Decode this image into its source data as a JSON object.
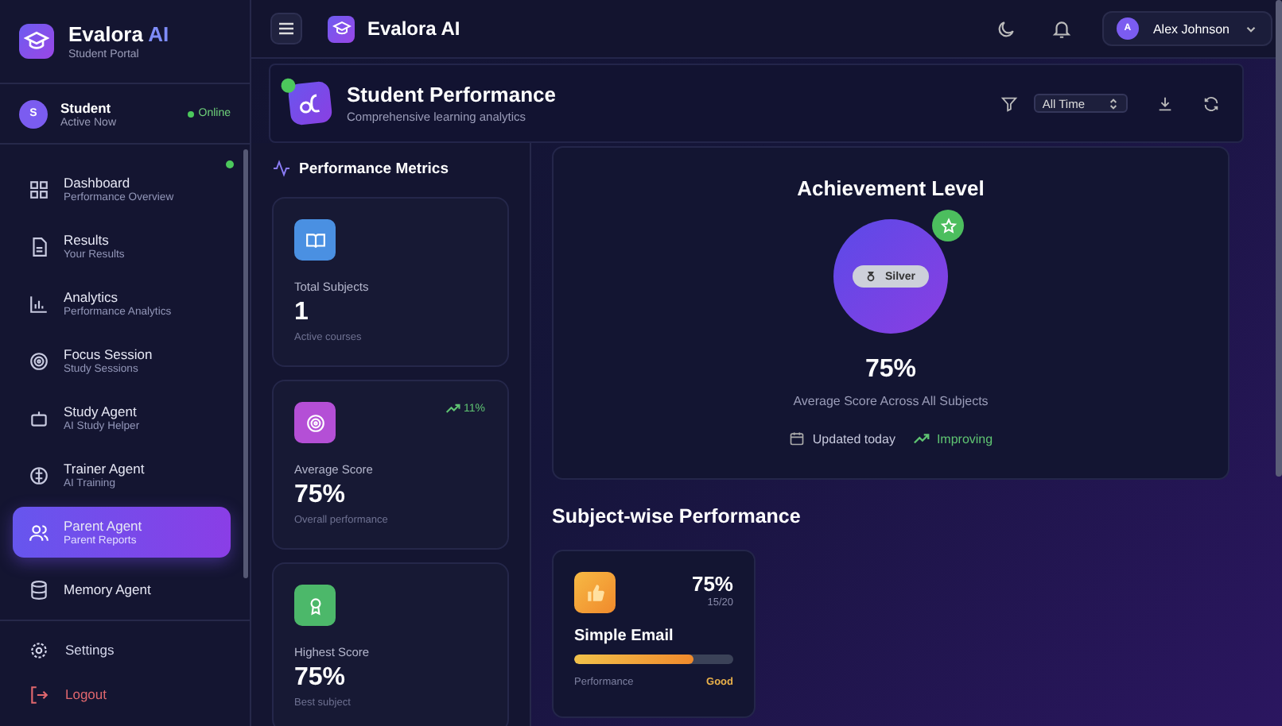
{
  "sidebar": {
    "brand": {
      "name": "Evalora",
      "name_accent": "AI",
      "subtitle": "Student Portal"
    },
    "user": {
      "initial": "S",
      "name": "Student",
      "status": "Active Now",
      "presence": "Online"
    },
    "items": [
      {
        "label": "Dashboard",
        "subtitle": "Performance Overview",
        "selected": false
      },
      {
        "label": "Results",
        "subtitle": "Your Results",
        "selected": false
      },
      {
        "label": "Analytics",
        "subtitle": "Performance Analytics",
        "selected": false
      },
      {
        "label": "Focus Session",
        "subtitle": "Study Sessions",
        "selected": false
      },
      {
        "label": "Study Agent",
        "subtitle": "AI Study Helper",
        "selected": false
      },
      {
        "label": "Trainer Agent",
        "subtitle": "AI Training",
        "selected": false
      },
      {
        "label": "Parent Agent",
        "subtitle": "Parent Reports",
        "selected": true
      },
      {
        "label": "Memory Agent",
        "selected": false
      }
    ],
    "footer": [
      {
        "label": "Settings",
        "kind": "normal"
      },
      {
        "label": "Logout",
        "kind": "danger"
      }
    ]
  },
  "topbar": {
    "title": "Evalora AI",
    "user": {
      "initial": "A",
      "name": "Alex Johnson"
    }
  },
  "header": {
    "title": "Student Performance",
    "subtitle": "Comprehensive learning analytics",
    "filter": "All Time"
  },
  "metrics": {
    "title": "Performance Metrics",
    "cards": [
      {
        "color": "#4a90e2",
        "label": "Total Subjects",
        "value": "1",
        "note": "Active courses"
      },
      {
        "color": "#b44fd6",
        "label": "Average Score",
        "value": "75%",
        "note": "Overall performance",
        "trend": "11%"
      },
      {
        "color": "#4cb86a",
        "label": "Highest Score",
        "value": "75%",
        "note": "Best subject"
      }
    ]
  },
  "achievement": {
    "title": "Achievement Level",
    "badge": "Silver",
    "score": "75%",
    "caption": "Average Score Across All Subjects",
    "updated": "Updated today",
    "trend": "Improving"
  },
  "subjects": {
    "title": "Subject-wise Performance",
    "items": [
      {
        "name": "Simple Email",
        "score": "75%",
        "fraction": "15/20",
        "level": 0.75,
        "label": "Performance",
        "rating": "Good"
      }
    ]
  }
}
